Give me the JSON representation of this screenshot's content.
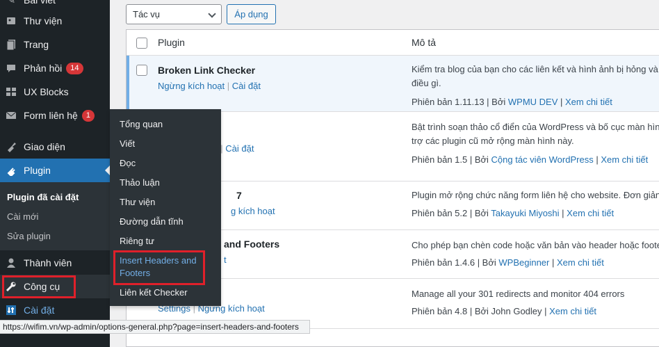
{
  "sidebar": {
    "top_partial": "Bài viết",
    "items": [
      {
        "label": "Thư viện",
        "icon": "media-icon"
      },
      {
        "label": "Trang",
        "icon": "page-icon"
      },
      {
        "label": "Phản hồi",
        "icon": "comments-icon",
        "badge": "14"
      },
      {
        "label": "UX Blocks",
        "icon": "blocks-icon"
      },
      {
        "label": "Form liên hệ",
        "icon": "mail-icon",
        "badge": "1"
      },
      {
        "label": "Giao diện",
        "icon": "appearance-icon"
      },
      {
        "label": "Plugin",
        "icon": "plugin-icon"
      },
      {
        "label": "Thành viên",
        "icon": "users-icon"
      },
      {
        "label": "Công cụ",
        "icon": "tools-icon"
      },
      {
        "label": "Cài đặt",
        "icon": "settings-icon"
      }
    ],
    "submenu": [
      "Plugin đã cài đặt",
      "Cài mới",
      "Sửa plugin"
    ]
  },
  "flyout": {
    "items": [
      "Tổng quan",
      "Viết",
      "Đọc",
      "Thảo luận",
      "Thư viện",
      "Đường dẫn tĩnh",
      "Riêng tư",
      "Insert Headers and Footers",
      "Liên kết Checker"
    ]
  },
  "toolbar": {
    "bulk_select": "Tác vụ",
    "apply_button": "Áp dụng"
  },
  "table": {
    "headers": {
      "plugin": "Plugin",
      "description": "Mô tả"
    },
    "rows": [
      {
        "name": "Broken Link Checker",
        "action1": "Ngừng kích hoạt",
        "action2": "Cài đặt",
        "desc1": "Kiểm tra blog của bạn cho các liên kết và hình ảnh bị hỏng và t",
        "desc2": "điều gì.",
        "version": "Phiên bản 1.11.13 | Bởi ",
        "author": "WPMU DEV",
        "sep": " | ",
        "details": "Xem chi tiết"
      },
      {
        "name": "",
        "action1": "t",
        "action2": "Cài đặt",
        "desc1": "Bật trình soạn thảo cổ điển của WordPress và bố cục màn hình",
        "desc2": "trợ các plugin cũ mở rộng màn hình này.",
        "version": "Phiên bản 1.5 | Bởi ",
        "author": "Cộng tác viên WordPress",
        "sep": " | ",
        "details": "Xem chi tiết"
      },
      {
        "name": "7",
        "action1": "g kích hoạt",
        "desc1": "Plugin mở rộng chức năng form liên hệ cho website. Đơn giản",
        "version": "Phiên bản 5.2 | Bởi ",
        "author": "Takayuki Miyoshi",
        "sep": " | ",
        "details": "Xem chi tiết"
      },
      {
        "name": "and Footers",
        "action1": "t",
        "desc1": "Cho phép bạn chèn code hoặc văn bản vào header hoặc foote",
        "version": "Phiên bản 1.4.6 | Bởi ",
        "author": "WPBeginner",
        "sep": " | ",
        "details": "Xem chi tiết"
      },
      {
        "name": "",
        "action1": "Settings",
        "action2": "Ngừng kích hoạt",
        "desc1": "Manage all your 301 redirects and monitor 404 errors",
        "version": "Phiên bản 4.8 | Bởi John Godley | ",
        "details": "Xem chi tiết"
      }
    ]
  },
  "statusbar": {
    "url": "https://wifim.vn/wp-admin/options-general.php?page=insert-headers-and-footers"
  },
  "colors": {
    "sidebar_bg": "#1d2327",
    "accent": "#2271b1",
    "highlight_box": "#e0202a",
    "badge": "#d63638"
  }
}
